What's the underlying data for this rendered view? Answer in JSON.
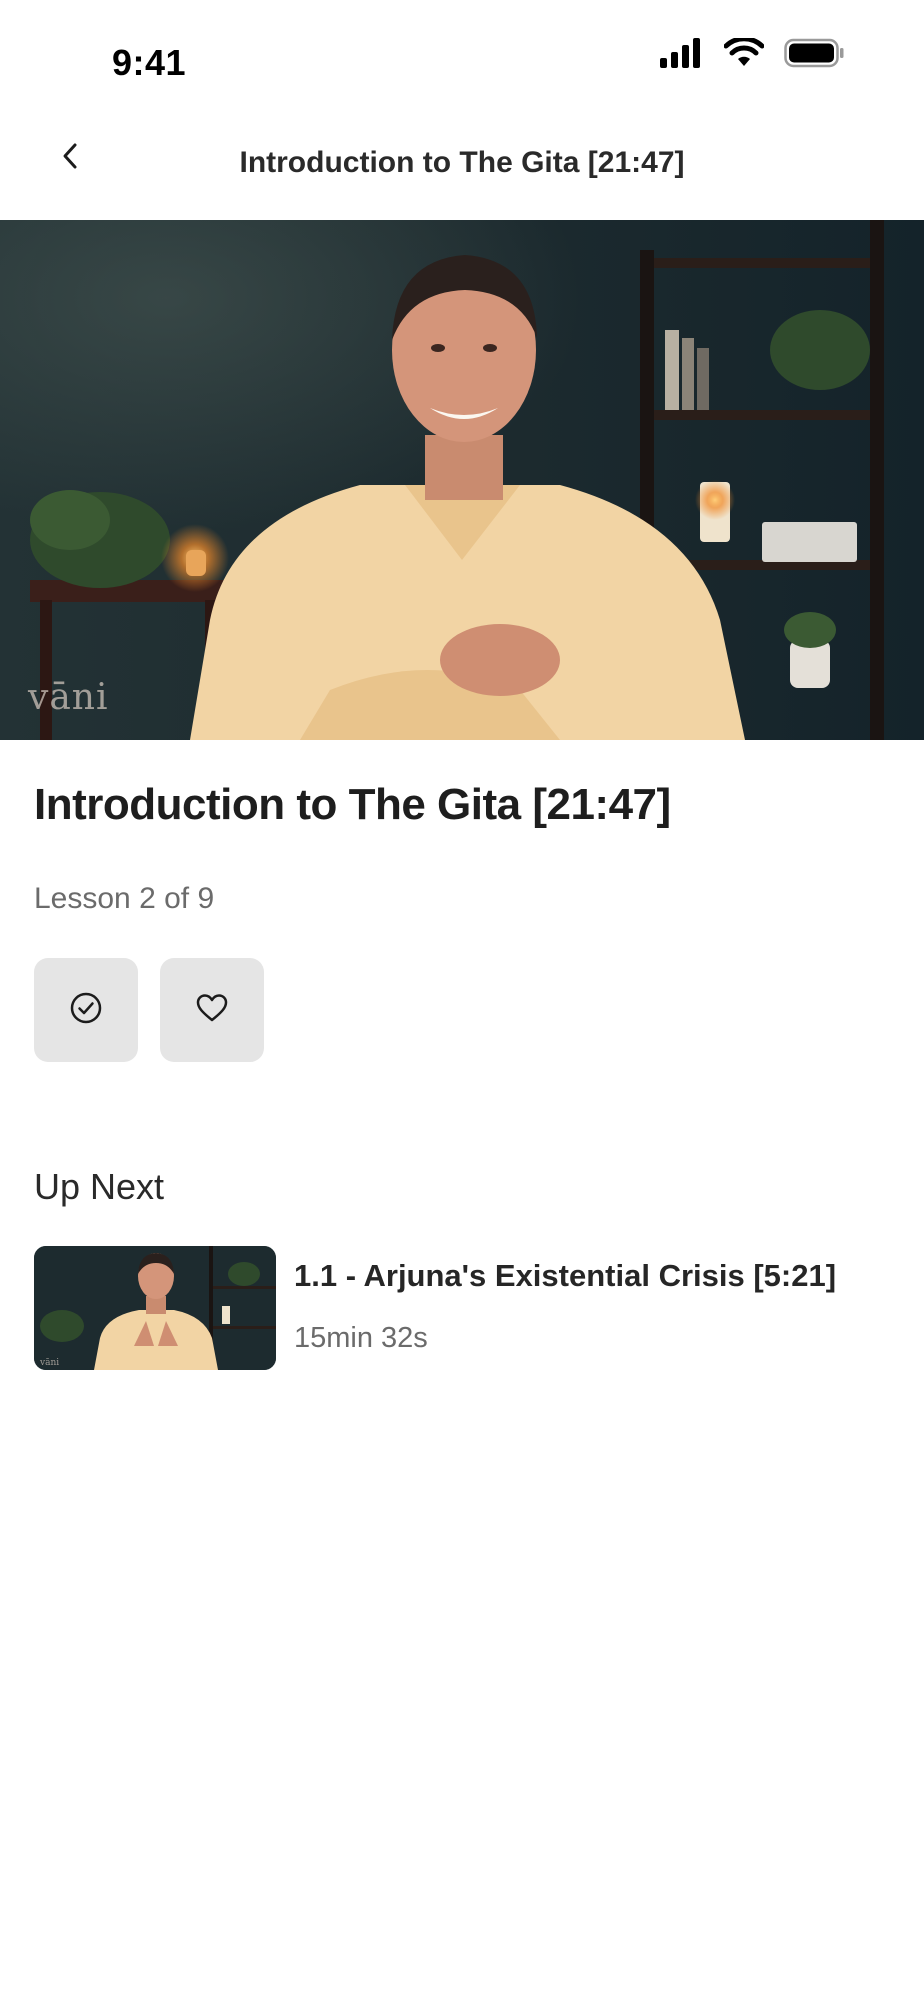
{
  "status_bar": {
    "time": "9:41",
    "icons": [
      "signal-icon",
      "wifi-icon",
      "battery-icon"
    ]
  },
  "nav": {
    "title": "Introduction to The Gita [21:47]",
    "back_icon": "chevron-left-icon"
  },
  "video": {
    "watermark": "vāni"
  },
  "lesson": {
    "title": "Introduction to The Gita [21:47]",
    "progress": "Lesson 2 of 9",
    "actions": [
      {
        "icon": "check-circle-icon"
      },
      {
        "icon": "heart-icon"
      }
    ]
  },
  "up_next": {
    "heading": "Up Next",
    "items": [
      {
        "title": "1.1 - Arjuna's Existential Crisis [5:21]",
        "duration": "15min 32s",
        "watermark": "vāni"
      }
    ]
  },
  "colors": {
    "action_bg": "#e5e5e5",
    "secondary_text": "#6b6b6b",
    "video_bg": "#1b2b30",
    "shirt": "#f2d4a4"
  }
}
